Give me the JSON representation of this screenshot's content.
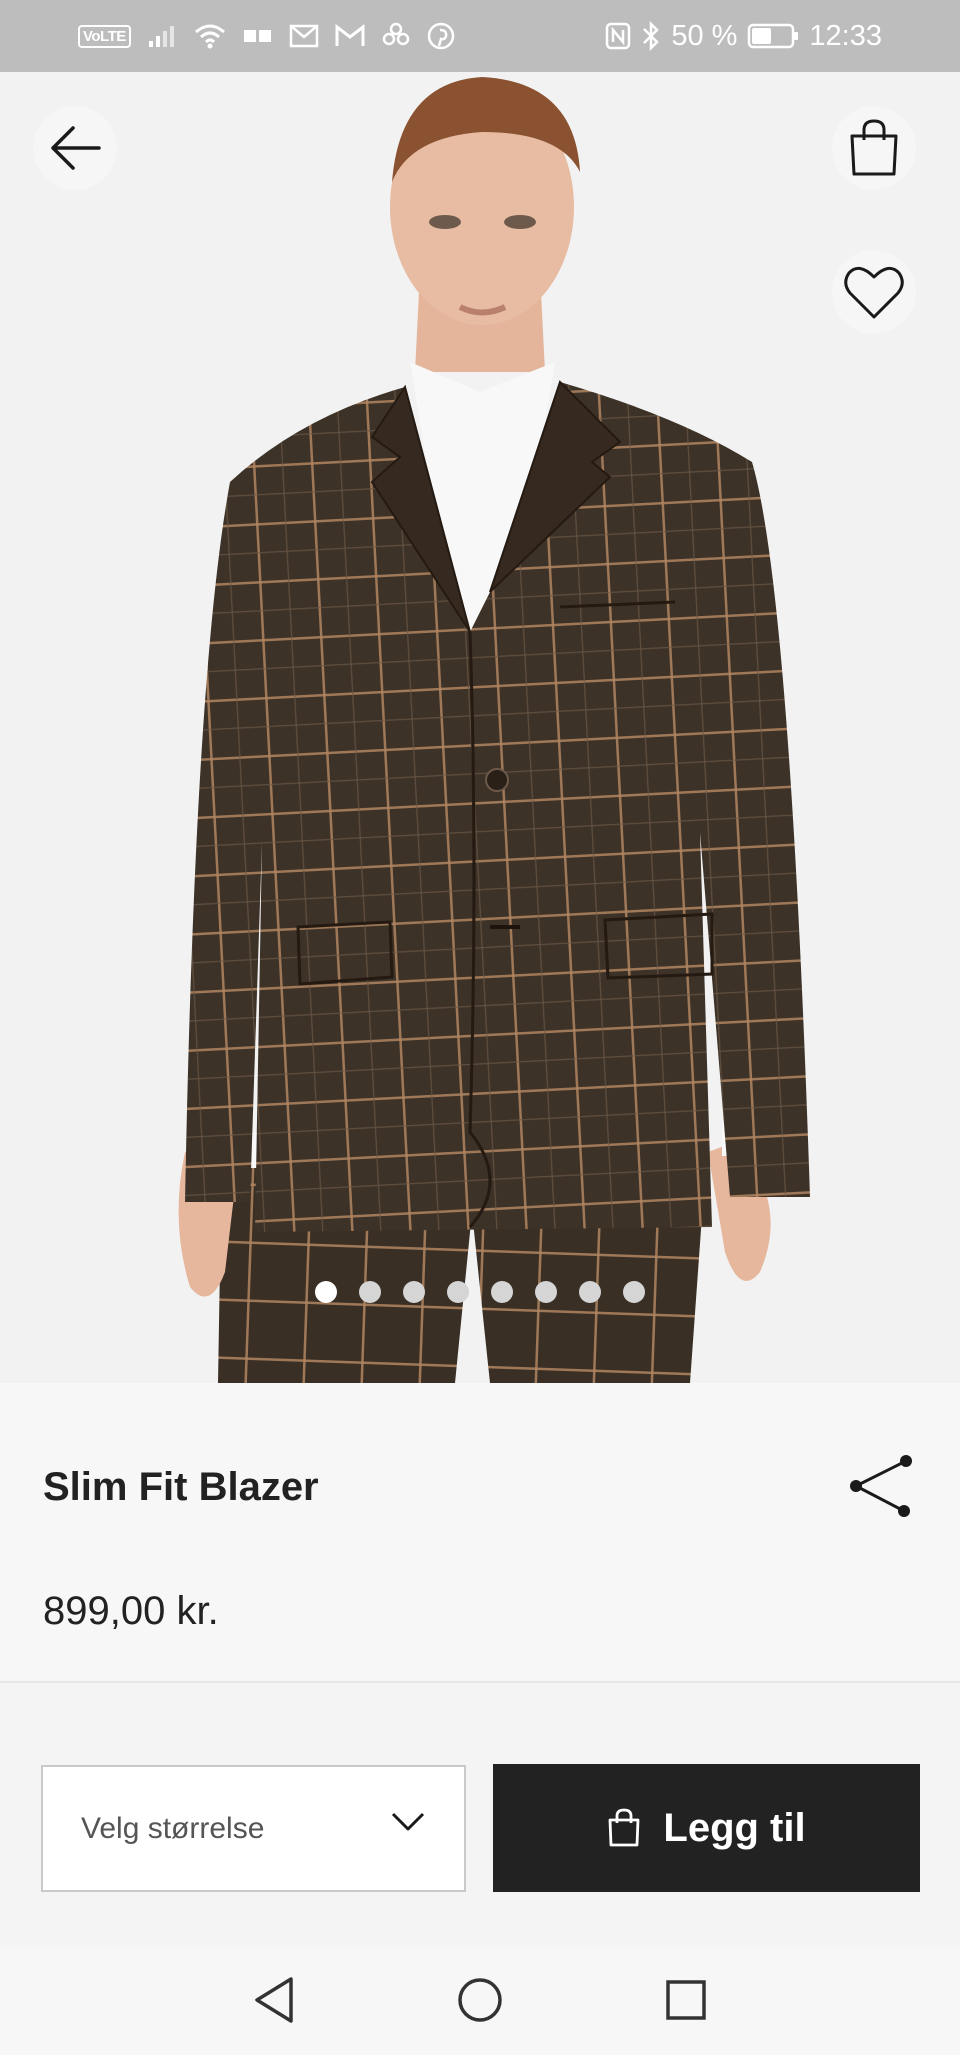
{
  "status_bar": {
    "volte": "VoLTE",
    "battery_percent": "50 %",
    "time": "12:33",
    "icons": [
      "signal-icon",
      "wifi-icon",
      "sim-icon",
      "mail-icon",
      "gmail-icon",
      "pinwheel-icon",
      "pinterest-icon",
      "nfc-icon",
      "bluetooth-icon",
      "battery-icon"
    ]
  },
  "hero": {
    "image_count": 8,
    "active_index": 0,
    "background_color": "#f2f2f2",
    "fabric_color": "#3d3227",
    "check_color": "#b08560"
  },
  "product": {
    "title": "Slim Fit Blazer",
    "price": "899,00 kr."
  },
  "actions": {
    "size_placeholder": "Velg størrelse",
    "add_to_cart_label": "Legg til"
  },
  "colors": {
    "button_dark": "#222222",
    "text": "#222222"
  }
}
